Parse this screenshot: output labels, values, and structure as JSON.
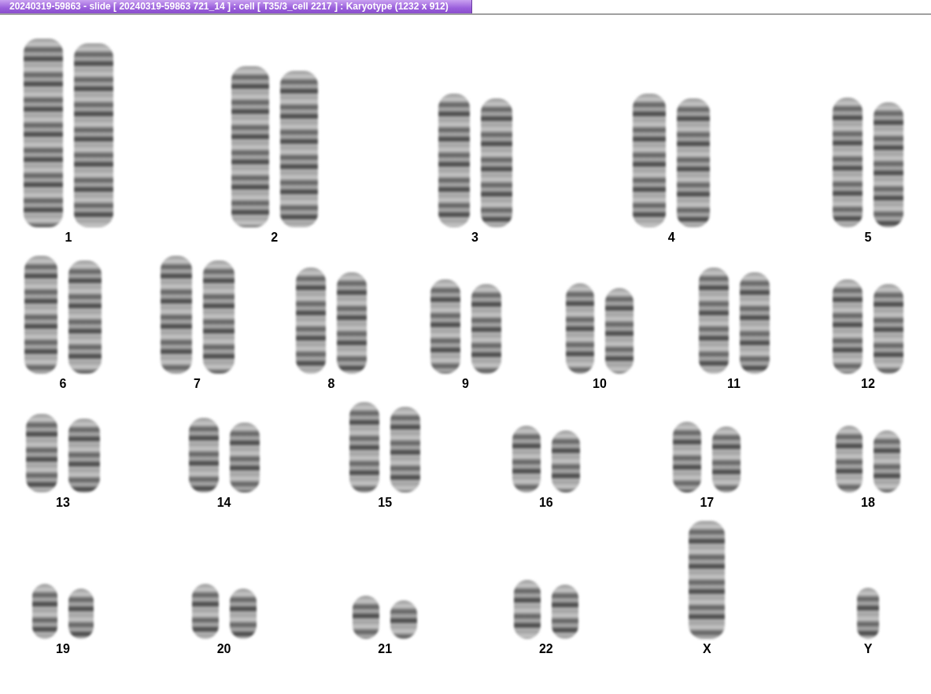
{
  "window": {
    "title": "20240319-59863 - slide [ 20240319-59863 721_14 ] : cell [ T35/3_cell 2217 ] : Karyotype  (1232 x 912)"
  },
  "karyotype": {
    "rows": [
      {
        "chromosomes": [
          {
            "label": "1",
            "kind": "pair"
          },
          {
            "label": "2",
            "kind": "pair"
          },
          {
            "label": "3",
            "kind": "pair"
          },
          {
            "label": "4",
            "kind": "pair"
          },
          {
            "label": "5",
            "kind": "pair"
          }
        ]
      },
      {
        "chromosomes": [
          {
            "label": "6",
            "kind": "pair"
          },
          {
            "label": "7",
            "kind": "pair"
          },
          {
            "label": "8",
            "kind": "pair"
          },
          {
            "label": "9",
            "kind": "pair"
          },
          {
            "label": "10",
            "kind": "pair"
          },
          {
            "label": "11",
            "kind": "pair"
          },
          {
            "label": "12",
            "kind": "pair"
          }
        ]
      },
      {
        "chromosomes": [
          {
            "label": "13",
            "kind": "pair"
          },
          {
            "label": "14",
            "kind": "pair"
          },
          {
            "label": "15",
            "kind": "pair"
          },
          {
            "label": "16",
            "kind": "pair"
          },
          {
            "label": "17",
            "kind": "pair"
          },
          {
            "label": "18",
            "kind": "pair"
          }
        ]
      },
      {
        "chromosomes": [
          {
            "label": "19",
            "kind": "pair"
          },
          {
            "label": "20",
            "kind": "pair"
          },
          {
            "label": "21",
            "kind": "pair"
          },
          {
            "label": "22",
            "kind": "pair"
          },
          {
            "label": "X",
            "kind": "single"
          },
          {
            "label": "Y",
            "kind": "single"
          }
        ]
      }
    ]
  }
}
